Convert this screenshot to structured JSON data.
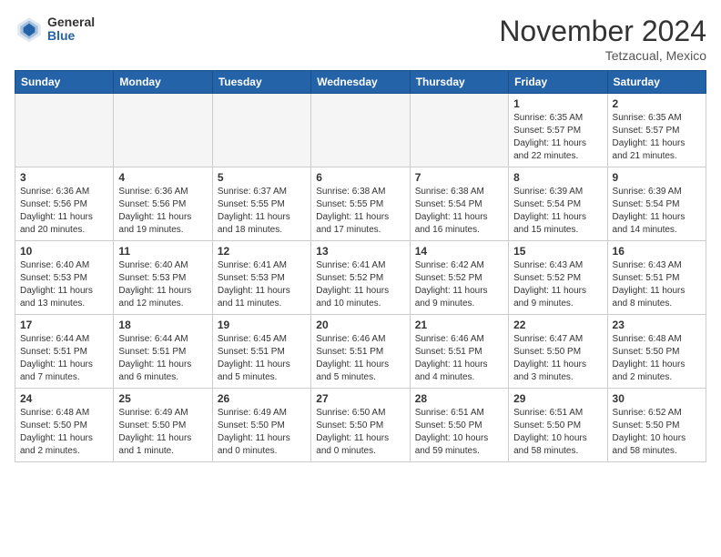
{
  "header": {
    "logo_general": "General",
    "logo_blue": "Blue",
    "month_title": "November 2024",
    "location": "Tetzacual, Mexico"
  },
  "days_of_week": [
    "Sunday",
    "Monday",
    "Tuesday",
    "Wednesday",
    "Thursday",
    "Friday",
    "Saturday"
  ],
  "weeks": [
    {
      "shaded": false,
      "days": [
        {
          "num": "",
          "info": ""
        },
        {
          "num": "",
          "info": ""
        },
        {
          "num": "",
          "info": ""
        },
        {
          "num": "",
          "info": ""
        },
        {
          "num": "",
          "info": ""
        },
        {
          "num": "1",
          "info": "Sunrise: 6:35 AM\nSunset: 5:57 PM\nDaylight: 11 hours\nand 22 minutes."
        },
        {
          "num": "2",
          "info": "Sunrise: 6:35 AM\nSunset: 5:57 PM\nDaylight: 11 hours\nand 21 minutes."
        }
      ]
    },
    {
      "shaded": true,
      "days": [
        {
          "num": "3",
          "info": "Sunrise: 6:36 AM\nSunset: 5:56 PM\nDaylight: 11 hours\nand 20 minutes."
        },
        {
          "num": "4",
          "info": "Sunrise: 6:36 AM\nSunset: 5:56 PM\nDaylight: 11 hours\nand 19 minutes."
        },
        {
          "num": "5",
          "info": "Sunrise: 6:37 AM\nSunset: 5:55 PM\nDaylight: 11 hours\nand 18 minutes."
        },
        {
          "num": "6",
          "info": "Sunrise: 6:38 AM\nSunset: 5:55 PM\nDaylight: 11 hours\nand 17 minutes."
        },
        {
          "num": "7",
          "info": "Sunrise: 6:38 AM\nSunset: 5:54 PM\nDaylight: 11 hours\nand 16 minutes."
        },
        {
          "num": "8",
          "info": "Sunrise: 6:39 AM\nSunset: 5:54 PM\nDaylight: 11 hours\nand 15 minutes."
        },
        {
          "num": "9",
          "info": "Sunrise: 6:39 AM\nSunset: 5:54 PM\nDaylight: 11 hours\nand 14 minutes."
        }
      ]
    },
    {
      "shaded": false,
      "days": [
        {
          "num": "10",
          "info": "Sunrise: 6:40 AM\nSunset: 5:53 PM\nDaylight: 11 hours\nand 13 minutes."
        },
        {
          "num": "11",
          "info": "Sunrise: 6:40 AM\nSunset: 5:53 PM\nDaylight: 11 hours\nand 12 minutes."
        },
        {
          "num": "12",
          "info": "Sunrise: 6:41 AM\nSunset: 5:53 PM\nDaylight: 11 hours\nand 11 minutes."
        },
        {
          "num": "13",
          "info": "Sunrise: 6:41 AM\nSunset: 5:52 PM\nDaylight: 11 hours\nand 10 minutes."
        },
        {
          "num": "14",
          "info": "Sunrise: 6:42 AM\nSunset: 5:52 PM\nDaylight: 11 hours\nand 9 minutes."
        },
        {
          "num": "15",
          "info": "Sunrise: 6:43 AM\nSunset: 5:52 PM\nDaylight: 11 hours\nand 9 minutes."
        },
        {
          "num": "16",
          "info": "Sunrise: 6:43 AM\nSunset: 5:51 PM\nDaylight: 11 hours\nand 8 minutes."
        }
      ]
    },
    {
      "shaded": true,
      "days": [
        {
          "num": "17",
          "info": "Sunrise: 6:44 AM\nSunset: 5:51 PM\nDaylight: 11 hours\nand 7 minutes."
        },
        {
          "num": "18",
          "info": "Sunrise: 6:44 AM\nSunset: 5:51 PM\nDaylight: 11 hours\nand 6 minutes."
        },
        {
          "num": "19",
          "info": "Sunrise: 6:45 AM\nSunset: 5:51 PM\nDaylight: 11 hours\nand 5 minutes."
        },
        {
          "num": "20",
          "info": "Sunrise: 6:46 AM\nSunset: 5:51 PM\nDaylight: 11 hours\nand 5 minutes."
        },
        {
          "num": "21",
          "info": "Sunrise: 6:46 AM\nSunset: 5:51 PM\nDaylight: 11 hours\nand 4 minutes."
        },
        {
          "num": "22",
          "info": "Sunrise: 6:47 AM\nSunset: 5:50 PM\nDaylight: 11 hours\nand 3 minutes."
        },
        {
          "num": "23",
          "info": "Sunrise: 6:48 AM\nSunset: 5:50 PM\nDaylight: 11 hours\nand 2 minutes."
        }
      ]
    },
    {
      "shaded": false,
      "days": [
        {
          "num": "24",
          "info": "Sunrise: 6:48 AM\nSunset: 5:50 PM\nDaylight: 11 hours\nand 2 minutes."
        },
        {
          "num": "25",
          "info": "Sunrise: 6:49 AM\nSunset: 5:50 PM\nDaylight: 11 hours\nand 1 minute."
        },
        {
          "num": "26",
          "info": "Sunrise: 6:49 AM\nSunset: 5:50 PM\nDaylight: 11 hours\nand 0 minutes."
        },
        {
          "num": "27",
          "info": "Sunrise: 6:50 AM\nSunset: 5:50 PM\nDaylight: 11 hours\nand 0 minutes."
        },
        {
          "num": "28",
          "info": "Sunrise: 6:51 AM\nSunset: 5:50 PM\nDaylight: 10 hours\nand 59 minutes."
        },
        {
          "num": "29",
          "info": "Sunrise: 6:51 AM\nSunset: 5:50 PM\nDaylight: 10 hours\nand 58 minutes."
        },
        {
          "num": "30",
          "info": "Sunrise: 6:52 AM\nSunset: 5:50 PM\nDaylight: 10 hours\nand 58 minutes."
        }
      ]
    }
  ]
}
